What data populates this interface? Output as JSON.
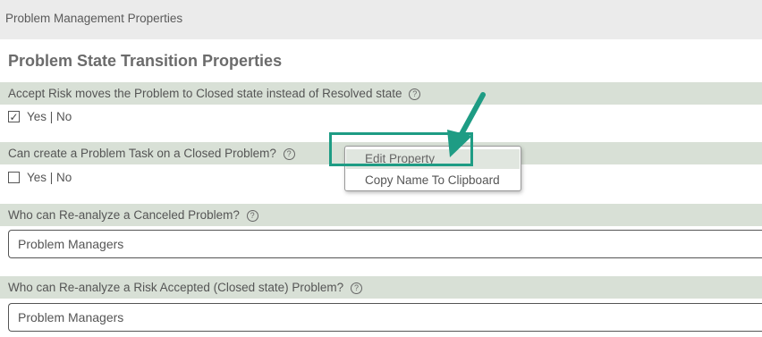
{
  "header": {
    "title": "Problem Management Properties"
  },
  "section": {
    "title": "Problem State Transition Properties"
  },
  "properties": [
    {
      "label": "Accept Risk moves the Problem to Closed state instead of Resolved state",
      "type": "checkbox",
      "checked": true,
      "value_label": "Yes | No"
    },
    {
      "label": "Can create a Problem Task on a Closed Problem?",
      "type": "checkbox",
      "checked": false,
      "value_label": "Yes | No"
    },
    {
      "label": "Who can Re-analyze a Canceled Problem?",
      "type": "select",
      "value": "Problem Managers"
    },
    {
      "label": "Who can Re-analyze a Risk Accepted (Closed state) Problem?",
      "type": "select",
      "value": "Problem Managers"
    }
  ],
  "help_icon_glyph": "?",
  "check_glyph": "✓",
  "context_menu": {
    "items": [
      {
        "label": "Edit Property",
        "highlighted": true
      },
      {
        "label": "Copy Name To Clipboard",
        "highlighted": false
      }
    ]
  },
  "colors": {
    "accent": "#1e9c84",
    "row_bg": "#d8e0d6",
    "header_bg": "#ebebeb"
  },
  "icons": [
    "help-icon",
    "checkbox-checked-icon",
    "checkbox-unchecked-icon",
    "annotation-arrow-icon"
  ]
}
